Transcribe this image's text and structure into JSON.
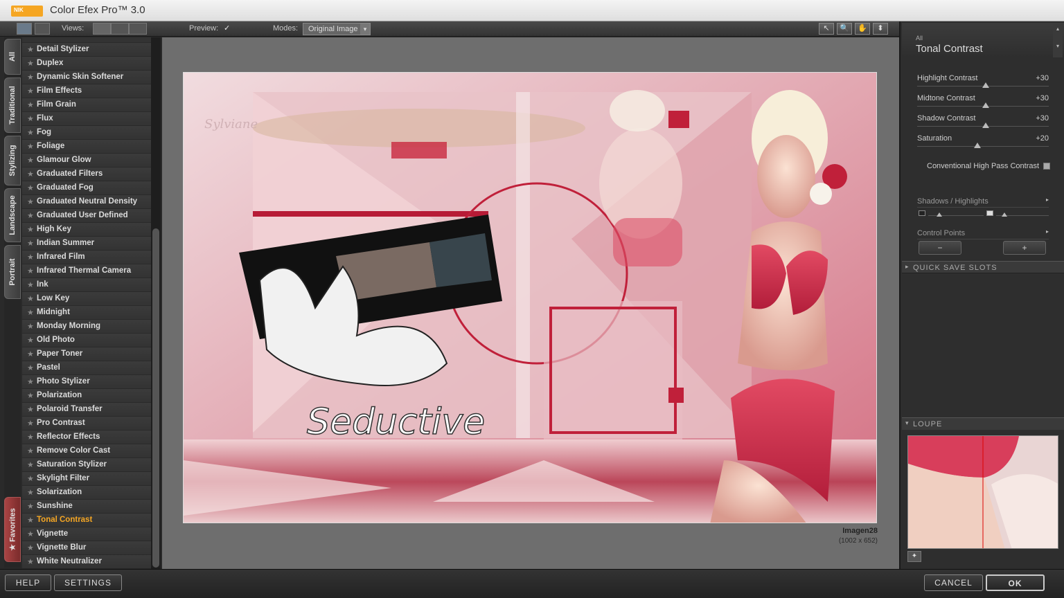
{
  "app": {
    "title": "Color Efex Pro™ 3.0",
    "logo_text": "NIK"
  },
  "toolbar": {
    "views_label": "Views:",
    "preview_label": "Preview:",
    "preview_check": "✓",
    "modes_label": "Modes:",
    "modes_value": "Original Image",
    "modes_arrow": "▾",
    "tools": [
      "↖",
      "🔍",
      "✋",
      "⬍"
    ]
  },
  "tabs": {
    "all": "All",
    "traditional": "Traditional",
    "stylizing": "Stylizing",
    "landscape": "Landscape",
    "portrait": "Portrait",
    "favorites": "★  Favorites"
  },
  "filters": [
    "Detail Stylizer",
    "Duplex",
    "Dynamic Skin Softener",
    "Film Effects",
    "Film Grain",
    "Flux",
    "Fog",
    "Foliage",
    "Glamour Glow",
    "Graduated Filters",
    "Graduated Fog",
    "Graduated Neutral Density",
    "Graduated User Defined",
    "High Key",
    "Indian Summer",
    "Infrared Film",
    "Infrared Thermal Camera",
    "Ink",
    "Low Key",
    "Midnight",
    "Monday Morning",
    "Old Photo",
    "Paper Toner",
    "Pastel",
    "Photo Stylizer",
    "Polarization",
    "Polaroid Transfer",
    "Pro Contrast",
    "Reflector Effects",
    "Remove Color Cast",
    "Saturation Stylizer",
    "Skylight Filter",
    "Solarization",
    "Sunshine",
    "Tonal Contrast",
    "Vignette",
    "Vignette Blur",
    "White Neutralizer"
  ],
  "active_filter": "Tonal Contrast",
  "image": {
    "name": "Imagen28",
    "size": "(1002 x 652)",
    "overlay_text": "Seductive",
    "watermark": "Sylviane"
  },
  "panel": {
    "category": "All",
    "filter_name": "Tonal Contrast",
    "sliders": [
      {
        "label": "Highlight Contrast",
        "value": "+30",
        "level": 0.52
      },
      {
        "label": "Midtone Contrast",
        "value": "+30",
        "level": 0.52
      },
      {
        "label": "Shadow Contrast",
        "value": "+30",
        "level": 0.52
      },
      {
        "label": "Saturation",
        "value": "+20",
        "level": 0.46
      }
    ],
    "checkbox_label": "Conventional High Pass Contrast",
    "shadows_highlights": "Shadows / Highlights",
    "control_points": "Control Points",
    "cp_minus": "−",
    "cp_plus": "+",
    "quick_save": "QUICK SAVE SLOTS",
    "loupe": "LOUPE",
    "arrow_right": "▸",
    "arrow_down": "▾"
  },
  "buttons": {
    "help": "HELP",
    "settings": "SETTINGS",
    "cancel": "CANCEL",
    "ok": "OK"
  },
  "colors": {
    "accent": "#f5a623",
    "active_filter": "#f5a623"
  }
}
